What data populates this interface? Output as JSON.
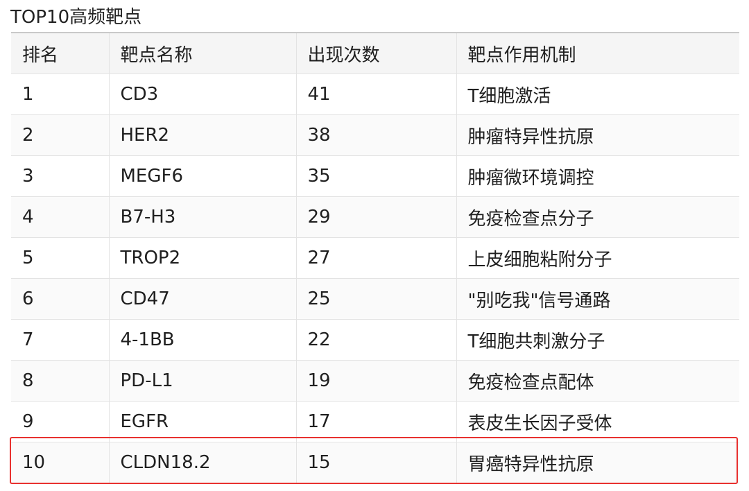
{
  "caption": "TOP10高频靶点",
  "table": {
    "headers": [
      "排名",
      "靶点名称",
      "出现次数",
      "靶点作用机制"
    ],
    "rows": [
      [
        "1",
        "CD3",
        "41",
        "T细胞激活"
      ],
      [
        "2",
        "HER2",
        "38",
        "肿瘤特异性抗原"
      ],
      [
        "3",
        "MEGF6",
        "35",
        "肿瘤微环境调控"
      ],
      [
        "4",
        "B7-H3",
        "29",
        "免疫检查点分子"
      ],
      [
        "5",
        "TROP2",
        "27",
        "上皮细胞粘附分子"
      ],
      [
        "6",
        "CD47",
        "25",
        "\"别吃我\"信号通路"
      ],
      [
        "7",
        "4-1BB",
        "22",
        "T细胞共刺激分子"
      ],
      [
        "8",
        "PD-L1",
        "19",
        "免疫检查点配体"
      ],
      [
        "9",
        "EGFR",
        "17",
        "表皮生长因子受体"
      ],
      [
        "10",
        "CLDN18.2",
        "15",
        "胃癌特异性抗原"
      ]
    ],
    "highlighted_row_rank": "10"
  },
  "colors": {
    "highlight_border": "#e8312f",
    "header_background": "#f5f5f5",
    "grid_line": "#e3e3e3"
  }
}
